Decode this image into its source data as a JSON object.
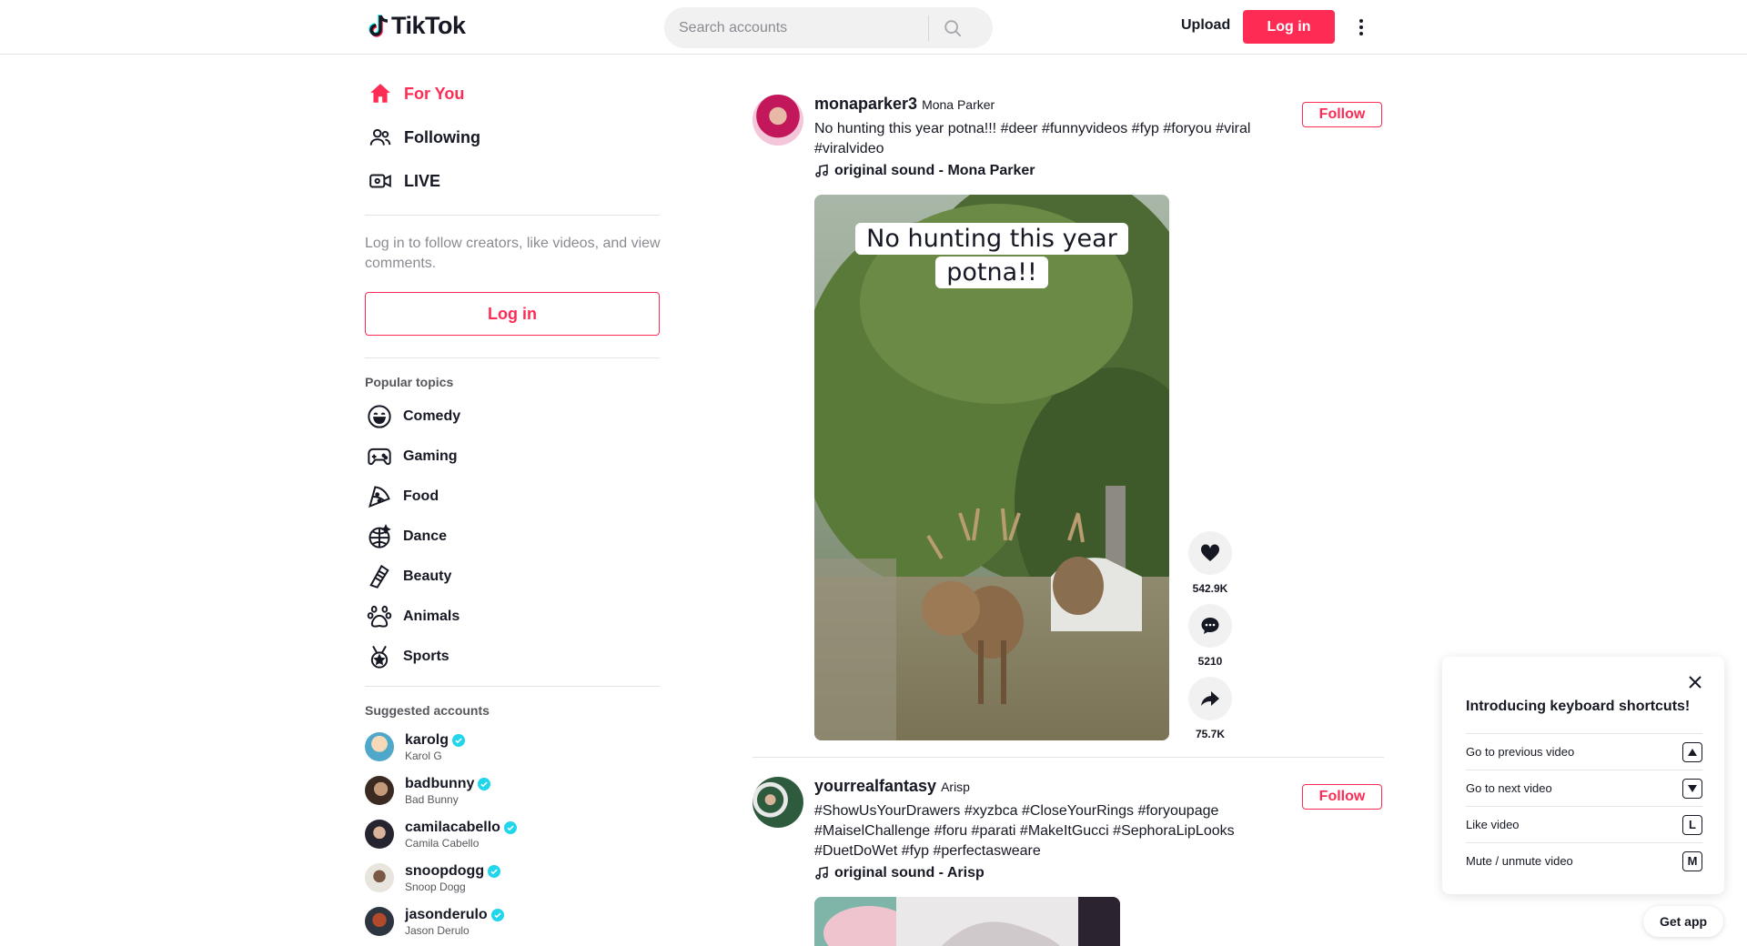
{
  "header": {
    "logo_text": "TikTok",
    "search_placeholder": "Search accounts",
    "upload_label": "Upload",
    "login_label": "Log in"
  },
  "sidebar": {
    "nav": [
      {
        "label": "For You",
        "icon": "home-icon",
        "active": true
      },
      {
        "label": "Following",
        "icon": "following-icon"
      },
      {
        "label": "LIVE",
        "icon": "live-icon"
      }
    ],
    "login_hint": "Log in to follow creators, like videos, and view comments.",
    "login_button": "Log in",
    "popular_topics_title": "Popular topics",
    "topics": [
      "Comedy",
      "Gaming",
      "Food",
      "Dance",
      "Beauty",
      "Animals",
      "Sports"
    ],
    "suggested_title": "Suggested accounts",
    "accounts": [
      {
        "username": "karolg",
        "name": "Karol G"
      },
      {
        "username": "badbunny",
        "name": "Bad Bunny"
      },
      {
        "username": "camilacabello",
        "name": "Camila Cabello"
      },
      {
        "username": "snoopdogg",
        "name": "Snoop Dogg"
      },
      {
        "username": "jasonderulo",
        "name": "Jason Derulo"
      }
    ]
  },
  "feed": {
    "posts": [
      {
        "username": "monaparker3",
        "nickname": "Mona Parker",
        "caption": "No hunting this year potna!!! #deer #funnyvideos #fyp #foryou #viral #viralvideo",
        "music": "original sound - Mona Parker",
        "follow_label": "Follow",
        "video_overlay_text": "No hunting this year potna!!",
        "likes": "542.9K",
        "comments": "5210",
        "shares": "75.7K"
      },
      {
        "username": "yourrealfantasy",
        "nickname": "Arisp",
        "caption": "#ShowUsYourDrawers #xyzbca #CloseYourRings #foryoupage #MaiselChallenge #foru #parati #MakeItGucci #SephoraLipLooks #DuetDoWet #fyp #perfectasweare",
        "music": "original sound - Arisp",
        "follow_label": "Follow"
      }
    ]
  },
  "keyboard_panel": {
    "title": "Introducing keyboard shortcuts!",
    "shortcuts": [
      {
        "label": "Go to previous video",
        "key": "▲"
      },
      {
        "label": "Go to next video",
        "key": "▼"
      },
      {
        "label": "Like video",
        "key": "L"
      },
      {
        "label": "Mute / unmute video",
        "key": "M"
      }
    ]
  },
  "get_app_label": "Get app",
  "colors": {
    "brand": "#fe2c55",
    "text": "#161823",
    "muted": "#8a8b91",
    "verified": "#20d5ec"
  }
}
